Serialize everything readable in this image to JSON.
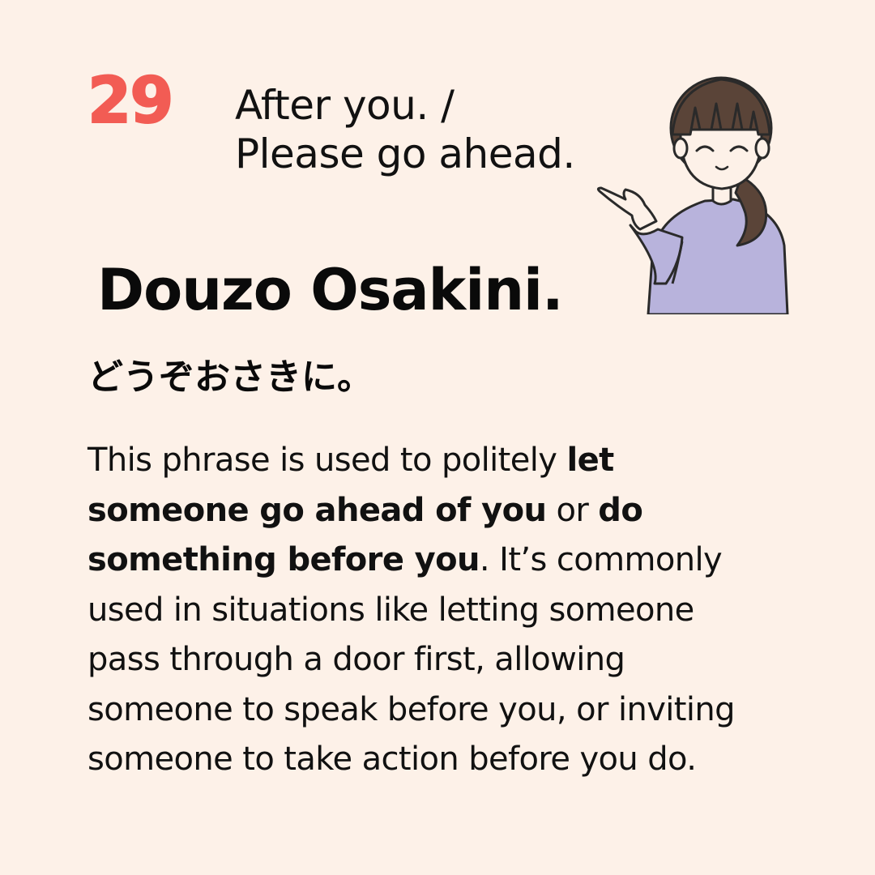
{
  "lesson": {
    "number": "29",
    "english_line1": "After you. /",
    "english_line2": "Please go ahead."
  },
  "phrase": {
    "romaji": "Douzo Osakini.",
    "kana": "どうぞおさきに。"
  },
  "description": {
    "p1": "This phrase is used to politely ",
    "b1": "let someone go ahead of you",
    "p2": " or ",
    "b2": "do something before you",
    "p3": ". It’s commonly used in situations like letting someone pass through a door first, allowing someone to speak before you, or inviting someone to take action before you do."
  },
  "illustration": {
    "icon": "girl-gesturing-icon"
  },
  "colors": {
    "background": "#fdf1e8",
    "accent": "#f25c54",
    "sweater": "#b8b3dc",
    "hair": "#5a4438",
    "text": "#0a0a0a"
  }
}
